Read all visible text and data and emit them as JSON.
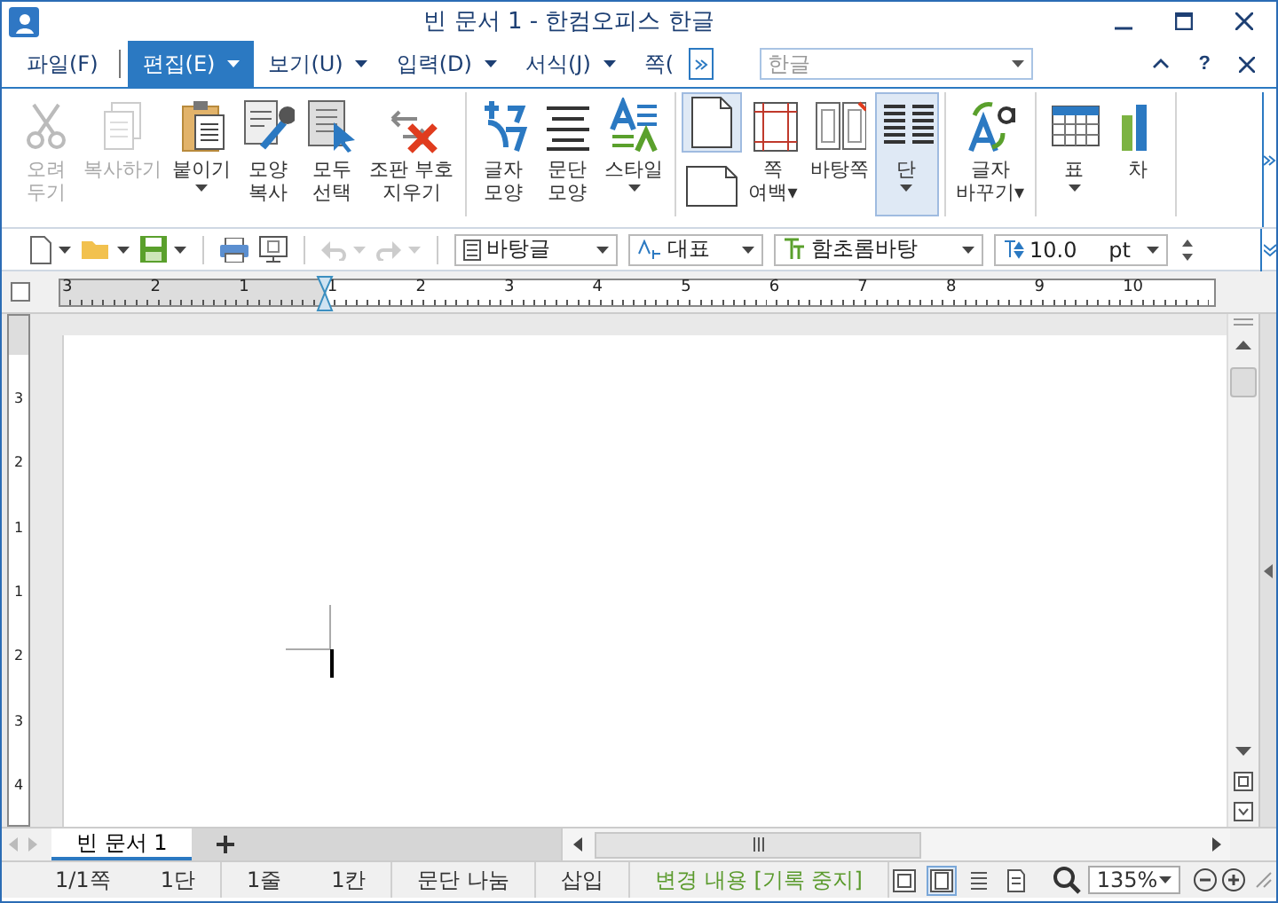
{
  "window": {
    "title": "빈 문서 1 - 한컴오피스 한글"
  },
  "menu": [
    {
      "label": "파일(F)",
      "selected": false,
      "dropdown": false
    },
    {
      "label": "편집(E)",
      "selected": true,
      "dropdown": true
    },
    {
      "label": "보기(U)",
      "selected": false,
      "dropdown": true
    },
    {
      "label": "입력(D)",
      "selected": false,
      "dropdown": true
    },
    {
      "label": "서식(J)",
      "selected": false,
      "dropdown": true
    },
    {
      "label": "쪽(",
      "selected": false,
      "dropdown": false
    }
  ],
  "help_search": {
    "value": "한글"
  },
  "help_label": "?",
  "ribbon": [
    {
      "items": [
        {
          "kind": "button",
          "label": "오려\n두기",
          "disabled": true,
          "dropdown": false,
          "selected": false
        },
        {
          "kind": "button",
          "label": "복사하기",
          "disabled": true,
          "dropdown": false,
          "selected": false
        },
        {
          "kind": "button",
          "label": "붙이기",
          "disabled": false,
          "dropdown": true,
          "selected": false
        },
        {
          "kind": "button",
          "label": "모양\n복사",
          "disabled": false,
          "dropdown": false,
          "selected": false
        },
        {
          "kind": "button",
          "label": "모두\n선택",
          "disabled": false,
          "dropdown": false,
          "selected": false
        },
        {
          "kind": "button",
          "label": "조판 부호\n지우기",
          "disabled": false,
          "dropdown": false,
          "selected": false
        }
      ]
    },
    {
      "items": [
        {
          "kind": "button",
          "label": "글자\n모양",
          "disabled": false,
          "dropdown": false,
          "selected": false
        },
        {
          "kind": "button",
          "label": "문단\n모양",
          "disabled": false,
          "dropdown": false,
          "selected": false
        },
        {
          "kind": "button",
          "label": "스타일",
          "disabled": false,
          "dropdown": true,
          "selected": false
        }
      ]
    },
    {
      "items": [
        {
          "kind": "orientation",
          "options": [
            {
              "selected": true
            },
            {
              "selected": false
            }
          ]
        },
        {
          "kind": "button",
          "label": "쪽\n여백▾",
          "disabled": false,
          "dropdown": false,
          "selected": false
        },
        {
          "kind": "button",
          "label": "바탕쪽",
          "disabled": false,
          "dropdown": false,
          "selected": false
        },
        {
          "kind": "button",
          "label": "단",
          "disabled": false,
          "dropdown": true,
          "selected": true
        }
      ]
    },
    {
      "items": [
        {
          "kind": "button",
          "label": "글자\n바꾸기▾",
          "disabled": false,
          "dropdown": false,
          "selected": false
        }
      ]
    },
    {
      "items": [
        {
          "kind": "button",
          "label": "표",
          "disabled": false,
          "dropdown": true,
          "selected": false
        },
        {
          "kind": "button",
          "label": "차",
          "disabled": false,
          "dropdown": false,
          "selected": false
        }
      ]
    }
  ],
  "toolbar": {
    "style": "바탕글",
    "language": "대표",
    "font": "함초롬바탕",
    "size": "10.0",
    "unit": "pt"
  },
  "ruler": {
    "h_labels": [
      "3",
      "2",
      "1",
      "1",
      "2",
      "3",
      "4",
      "5",
      "6",
      "7",
      "8",
      "9",
      "10"
    ],
    "v_labels": [
      "3",
      "2",
      "1",
      "1",
      "2",
      "3",
      "4"
    ]
  },
  "doc_tabs": [
    {
      "label": "빈 문서 1",
      "selected": true
    }
  ],
  "status_bar": {
    "items": [
      "1/1쪽",
      "1단",
      "1줄",
      "1칸",
      "문단 나눔",
      "삽입"
    ],
    "track_changes": "변경 내용 [기록 중지]",
    "view_buttons": [
      {
        "selected": false
      },
      {
        "selected": true
      },
      {
        "selected": false
      },
      {
        "selected": false
      }
    ],
    "zoom": "135%"
  }
}
